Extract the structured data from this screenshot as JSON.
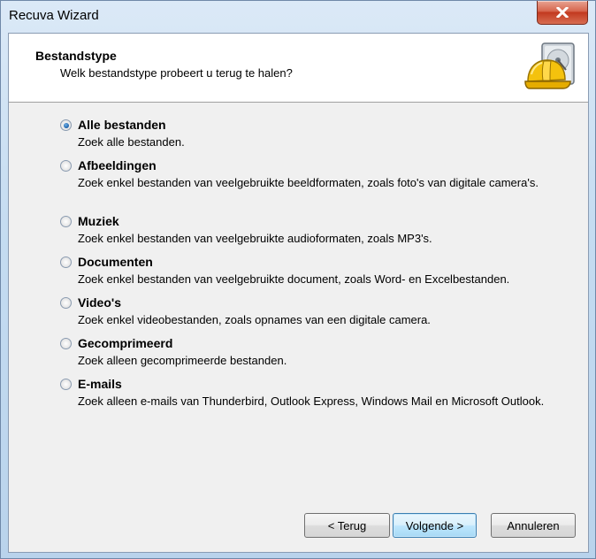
{
  "window": {
    "title": "Recuva Wizard"
  },
  "header": {
    "title": "Bestandstype",
    "subtitle": "Welk bestandstype probeert u terug te halen?"
  },
  "options": [
    {
      "label": "Alle bestanden",
      "description": "Zoek alle bestanden.",
      "checked": true
    },
    {
      "label": "Afbeeldingen",
      "description": "Zoek enkel bestanden van veelgebruikte beeldformaten, zoals foto's van digitale camera's.",
      "checked": false
    },
    {
      "label": "Muziek",
      "description": "Zoek enkel bestanden van veelgebruikte audioformaten, zoals MP3's.",
      "checked": false
    },
    {
      "label": "Documenten",
      "description": "Zoek enkel bestanden van veelgebruikte document, zoals Word- en Excelbestanden.",
      "checked": false
    },
    {
      "label": "Video's",
      "description": "Zoek enkel videobestanden, zoals opnames van een digitale camera.",
      "checked": false
    },
    {
      "label": "Gecomprimeerd",
      "description": "Zoek alleen gecomprimeerde bestanden.",
      "checked": false
    },
    {
      "label": "E-mails",
      "description": "Zoek alleen e-mails van Thunderbird, Outlook Express, Windows Mail en Microsoft Outlook.",
      "checked": false
    }
  ],
  "buttons": {
    "back": "< Terug",
    "next": "Volgende >",
    "cancel": "Annuleren"
  },
  "icons": {
    "close": "close-icon",
    "logo": "hard-hat-disk-icon"
  },
  "colors": {
    "frame": "#c5dcf1",
    "close_button": "#c2391f",
    "radio_selected": "#1b5fa8",
    "default_button_border": "#3c7fb1"
  }
}
